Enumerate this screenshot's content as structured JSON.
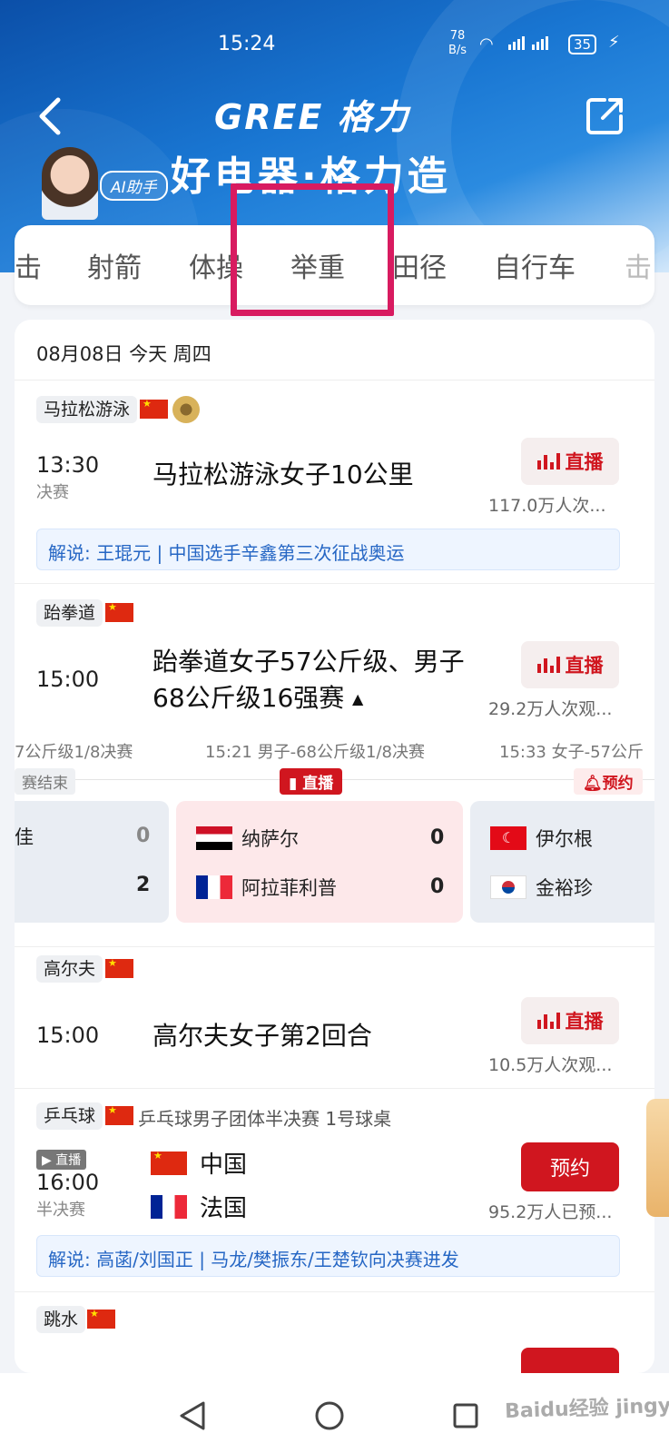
{
  "status_bar": {
    "time": "15:24",
    "net_speed": "78",
    "net_unit": "B/s",
    "battery": "35"
  },
  "header": {
    "brand": "GREE 格力",
    "slogan": "好电器·格力造",
    "ai_label": "AI助手"
  },
  "tabs": [
    "击",
    "射箭",
    "体操",
    "举重",
    "田径",
    "自行车",
    "击"
  ],
  "date_header": "08月08日 今天 周四",
  "events": [
    {
      "category": "马拉松游泳",
      "time": "13:30",
      "stage": "决赛",
      "title": "马拉松游泳女子10公里",
      "button": "直播",
      "viewers": "117.0万人次...",
      "comment": "解说: 王琨元 | 中国选手辛鑫第三次征战奥运"
    },
    {
      "category": "跆拳道",
      "time": "15:00",
      "title_line1": "跆拳道女子57公斤级、男子",
      "title_line2": "68公斤级16强赛",
      "button": "直播",
      "viewers": "29.2万人次观..."
    },
    {
      "category": "高尔夫",
      "time": "15:00",
      "title": "高尔夫女子第2回合",
      "button": "直播",
      "viewers": "10.5万人次观..."
    },
    {
      "category": "乒乓球",
      "subtitle": "乒乓球男子团体半决赛 1号球桌",
      "live_tag": "直播",
      "time": "16:00",
      "stage": "半决赛",
      "team1": "中国",
      "team2": "法国",
      "button": "预约",
      "viewers": "95.2万人已预...",
      "comment": "解说: 高菡/刘国正 | 马龙/樊振东/王楚钦向决赛进发"
    },
    {
      "category": "跳水"
    }
  ],
  "matches": {
    "timeline": [
      "7公斤级1/8决赛",
      "15:21 男子-68公斤级1/8决赛",
      "15:33 女子-57公斤"
    ],
    "status": [
      "赛结束",
      "直播",
      "预约"
    ],
    "left": {
      "name1": "佳",
      "score1": "0",
      "score2": "2"
    },
    "center": {
      "name1": "纳萨尔",
      "score1": "0",
      "name2": "阿拉菲利普",
      "score2": "0"
    },
    "right": {
      "name1": "伊尔根",
      "name2": "金裕珍"
    }
  },
  "watermark": "Baidu经验 jingyan.baidu.com",
  "colors": {
    "accent": "#d0161f",
    "brand_blue": "#1976d2",
    "highlight": "#d81b60"
  }
}
